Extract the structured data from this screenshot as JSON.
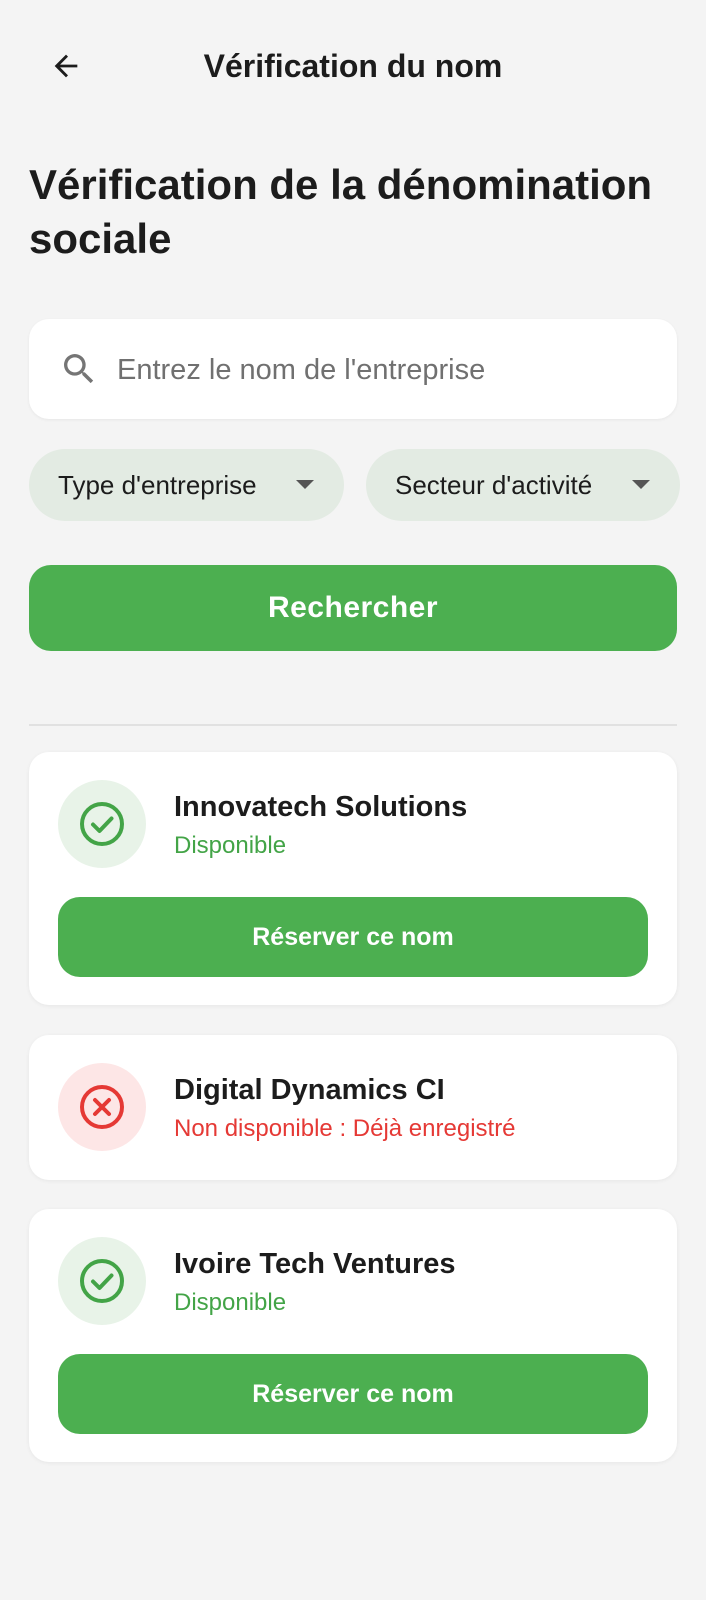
{
  "appbar": {
    "title": "Vérification du nom",
    "back_icon": "arrow-left-icon"
  },
  "page_title": "Vérification de la dénomination sociale",
  "search": {
    "placeholder": "Entrez le nom de l'entreprise",
    "value": "",
    "icon": "search-icon"
  },
  "filters": [
    {
      "label": "Type d'entreprise",
      "icon": "caret-down-icon"
    },
    {
      "label": "Secteur d'activité",
      "icon": "caret-down-icon"
    }
  ],
  "search_button": "Rechercher",
  "results": [
    {
      "name": "Innovatech Solutions",
      "status": "Disponible",
      "available": true,
      "icon": "check-circle-icon",
      "action": "Réserver ce nom"
    },
    {
      "name": "Digital Dynamics CI",
      "status": "Non disponible : Déjà enregistré",
      "available": false,
      "icon": "x-circle-icon"
    },
    {
      "name": "Ivoire Tech Ventures",
      "status": "Disponible",
      "available": true,
      "icon": "check-circle-icon",
      "action": "Réserver ce nom"
    }
  ],
  "colors": {
    "primary": "#4caf50",
    "available_text": "#43a447",
    "unavailable_text": "#e53935",
    "background": "#f4f4f4",
    "chip_background": "#e3ebe3"
  }
}
